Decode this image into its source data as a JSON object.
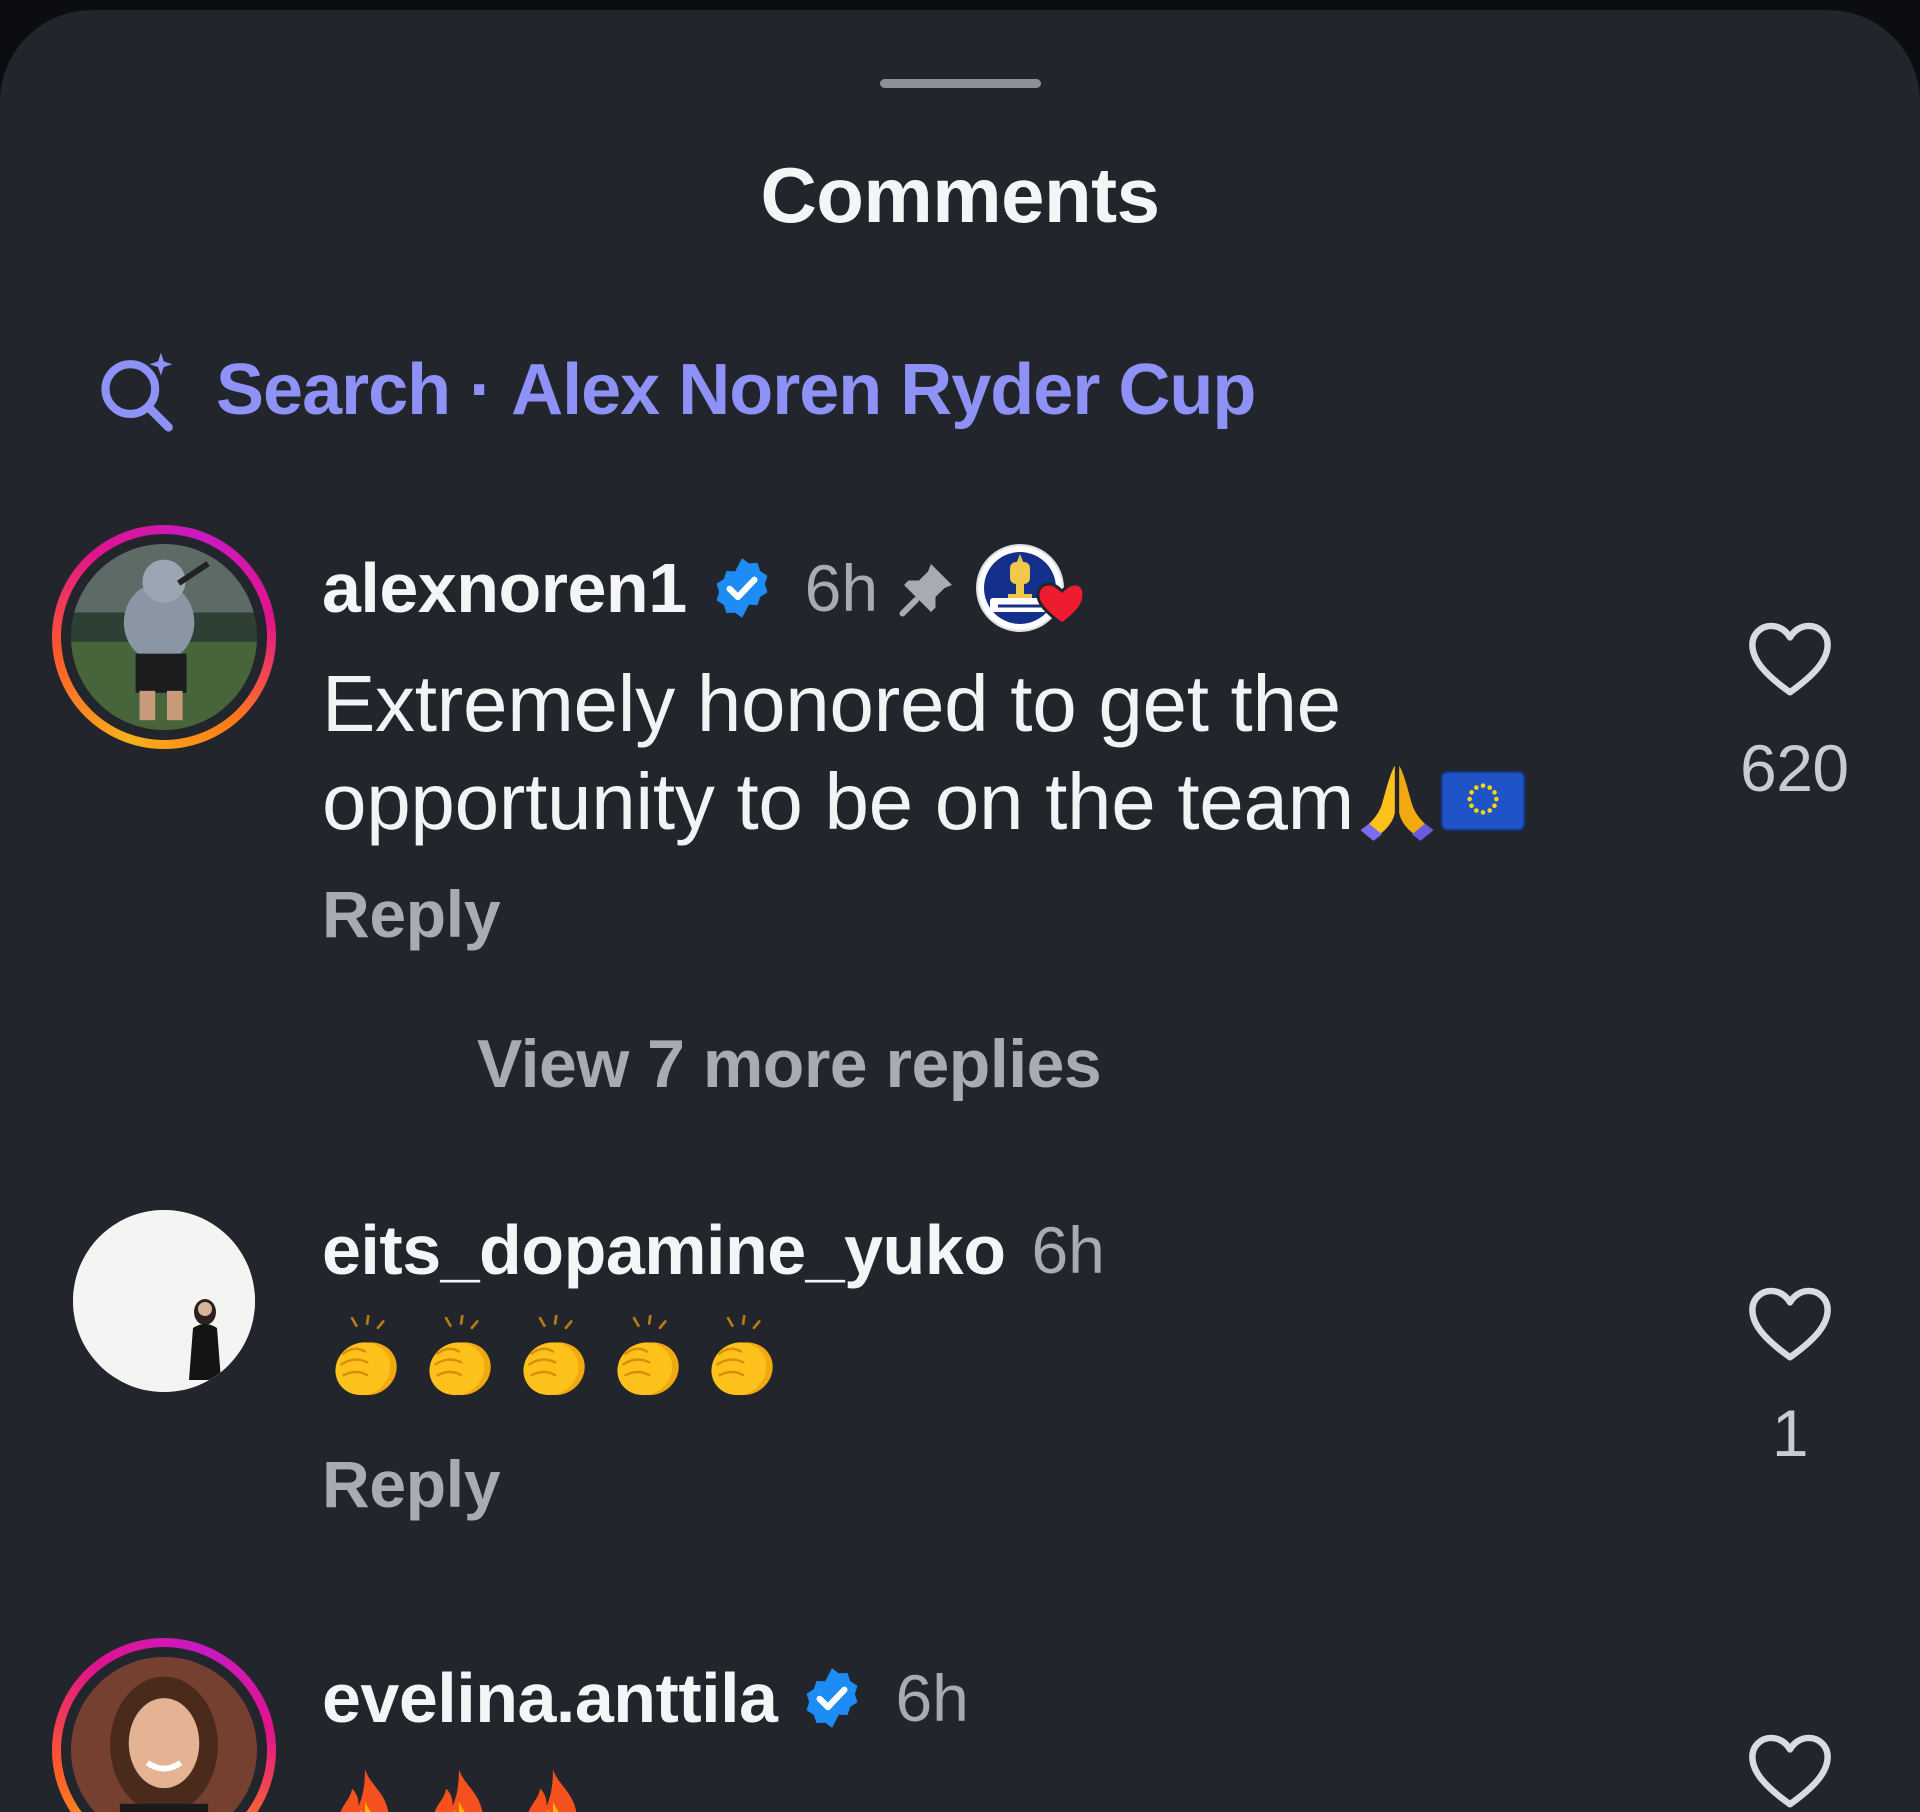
{
  "sheet": {
    "title": "Comments",
    "search_prefix": "Search",
    "search_separator": " · ",
    "search_query": "Alex Noren Ryder Cup"
  },
  "comments": [
    {
      "username": "alexnoren1",
      "verified": true,
      "time": "6h",
      "pinned": true,
      "text": "Extremely honored to get the opportunity to be on the team",
      "emojis": [
        "folded-hands",
        "eu-flag"
      ],
      "reply_label": "Reply",
      "likes": "620",
      "view_more_replies": "View 7 more replies"
    },
    {
      "username": "eits_dopamine_yuko",
      "verified": false,
      "time": "6h",
      "emojis": [
        "clapping-hands",
        "clapping-hands",
        "clapping-hands",
        "clapping-hands",
        "clapping-hands"
      ],
      "reply_label": "Reply",
      "likes": "1"
    },
    {
      "username": "evelina.anttila",
      "verified": true,
      "time": "6h",
      "emojis": [
        "fire",
        "fire",
        "fire"
      ]
    }
  ],
  "colors": {
    "background": "#23252c",
    "accent_search": "#8e92f7",
    "verified_blue": "#1d8cf5",
    "text_primary": "#f4f5f7",
    "text_secondary": "#a9abb2"
  }
}
